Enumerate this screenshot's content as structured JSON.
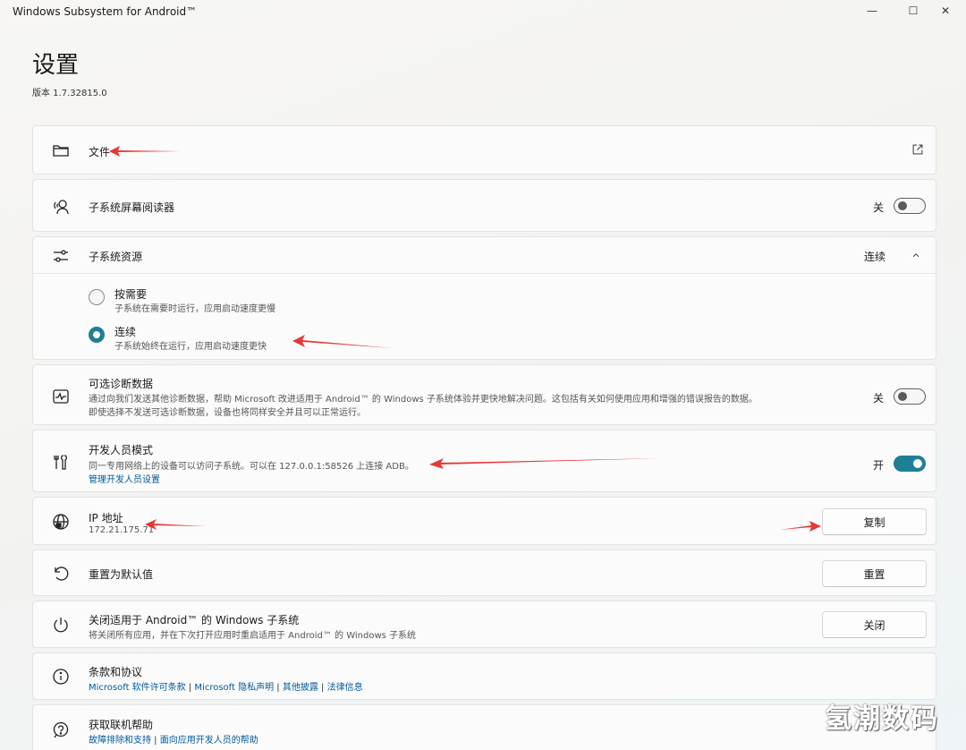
{
  "window": {
    "title": "Windows Subsystem for Android™",
    "minimize_glyph": "—",
    "maximize_glyph": "☐",
    "close_glyph": "✕"
  },
  "header": {
    "title": "设置",
    "version": "版本 1.7.32815.0"
  },
  "files": {
    "title": "文件",
    "icon": "folder-icon",
    "action_icon": "open-external-icon"
  },
  "screen_reader": {
    "title": "子系统屏幕阅读器",
    "icon": "screen-reader-icon",
    "state_label": "关",
    "enabled": false
  },
  "resources": {
    "title": "子系统资源",
    "icon": "sliders-icon",
    "current_value": "连续",
    "expanded": true,
    "options": [
      {
        "title": "按需要",
        "desc": "子系统在需要时运行，应用启动速度更慢",
        "selected": false
      },
      {
        "title": "连续",
        "desc": "子系统始终在运行，应用启动速度更快",
        "selected": true
      }
    ]
  },
  "diagnostics": {
    "title": "可选诊断数据",
    "icon": "pulse-icon",
    "desc_line1": "通过向我们发送其他诊断数据，帮助 Microsoft 改进适用于 Android™ 的 Windows 子系统体验并更快地解决问题。这包括有关如何使用应用和增强的错误报告的数据。",
    "desc_line2": "即使选择不发送可选诊断数据，设备也将同样安全并且可以正常运行。",
    "state_label": "关",
    "enabled": false
  },
  "developer": {
    "title": "开发人员模式",
    "icon": "tools-icon",
    "desc": "同一专用网络上的设备可以访问子系统。可以在 127.0.0.1:58526 上连接 ADB。",
    "link": "管理开发人员设置",
    "state_label": "开",
    "enabled": true
  },
  "ip": {
    "title": "IP 地址",
    "icon": "globe-icon",
    "value": "172.21.175.71",
    "button": "复制"
  },
  "reset": {
    "title": "重置为默认值",
    "icon": "reset-icon",
    "button": "重置"
  },
  "shutdown": {
    "title": "关闭适用于 Android™ 的 Windows 子系统",
    "icon": "power-icon",
    "desc": "将关闭所有应用，并在下次打开应用时重启适用于 Android™ 的 Windows 子系统",
    "button": "关闭"
  },
  "terms": {
    "title": "条款和协议",
    "icon": "info-icon",
    "links": [
      "Microsoft 软件许可条款",
      "Microsoft 隐私声明",
      "其他披露",
      "法律信息"
    ],
    "separator": " | "
  },
  "help": {
    "title": "获取联机帮助",
    "icon": "help-icon",
    "links": [
      "故障排除和支持",
      "面向应用开发人员的帮助"
    ],
    "separator": " | "
  },
  "colors": {
    "accent": "#1f7f95",
    "link": "#005a9e",
    "annotation_arrow": "#e53935"
  },
  "watermark": "氢潮数码"
}
